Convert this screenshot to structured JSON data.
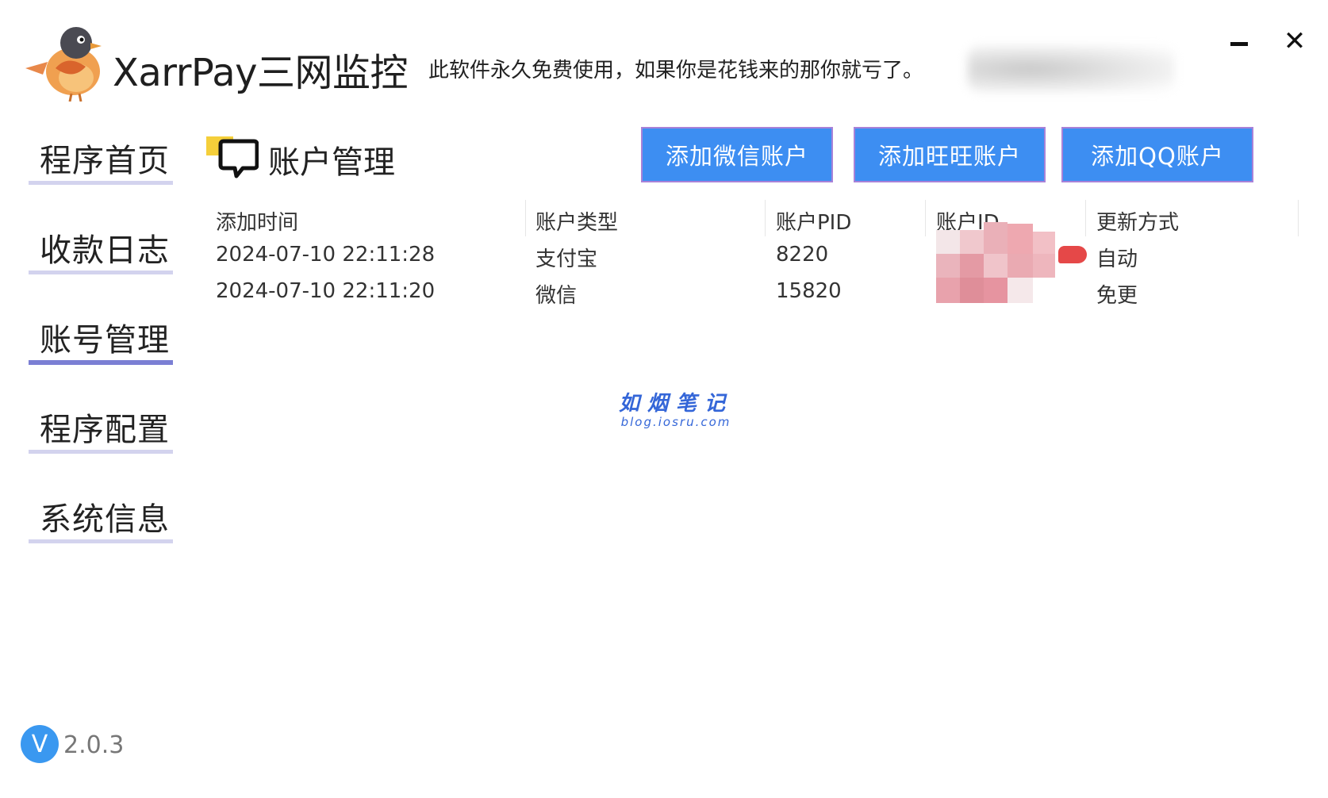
{
  "header": {
    "app_title": "XarrPay三网监控",
    "notice": "此软件永久免费使用，如果你是花钱来的那你就亏了。"
  },
  "window_controls": {
    "minimize": "minimize-icon",
    "close": "close-icon",
    "close_glyph": "✕"
  },
  "sidebar": {
    "items": [
      {
        "label": "程序首页",
        "active": false
      },
      {
        "label": "收款日志",
        "active": false
      },
      {
        "label": "账号管理",
        "active": true
      },
      {
        "label": "程序配置",
        "active": false
      },
      {
        "label": "系统信息",
        "active": false
      }
    ]
  },
  "section": {
    "title": "账户管理",
    "icon": "chat-bubble-icon"
  },
  "actions": {
    "add_wechat": "添加微信账户",
    "add_wangwang": "添加旺旺账户",
    "add_qq": "添加QQ账户"
  },
  "table": {
    "columns": [
      "添加时间",
      "账户类型",
      "账户PID",
      "账户ID",
      "更新方式"
    ],
    "rows": [
      {
        "time": "2024-07-10 22:11:28",
        "type": "支付宝",
        "pid": "8220",
        "update": "自动"
      },
      {
        "time": "2024-07-10 22:11:20",
        "type": "微信",
        "pid": "15820",
        "update": "免更"
      }
    ]
  },
  "watermark": {
    "cn": "如烟笔记",
    "url": "blog.iosru.com"
  },
  "version": {
    "badge": "V",
    "number": "2.0.3"
  },
  "colors": {
    "accent": "#3d8ef2",
    "nav_active": "#7b7fd4",
    "nav_inactive": "#d3d3ee",
    "watermark": "#3466d8"
  }
}
